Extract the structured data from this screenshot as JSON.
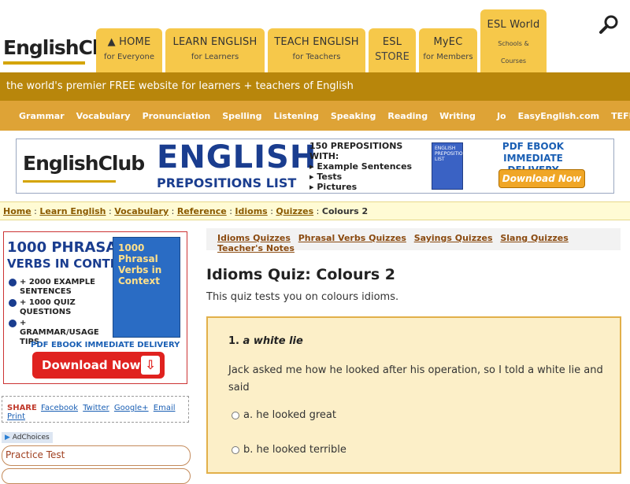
{
  "header": {
    "logo": "EnglishClub",
    "tabs": [
      {
        "line1": "HOME",
        "line2": "for Everyone",
        "icon": "home-icon"
      },
      {
        "line1": "LEARN ENGLISH",
        "line2": "for Learners"
      },
      {
        "line1": "TEACH ENGLISH",
        "line2": "for Teachers"
      },
      {
        "line1": "ESL",
        "line2": "STORE"
      },
      {
        "line1": "MyEC",
        "line2": "for Members"
      },
      {
        "line1": "ESL World",
        "line2": "Schools &",
        "line3": "Courses"
      }
    ]
  },
  "tagline": "the world's premier FREE website for learners + teachers of English",
  "subnav": [
    "Grammar",
    "Vocabulary",
    "Pronunciation",
    "Spelling",
    "Listening",
    "Speaking",
    "Reading",
    "Writing",
    "Jo",
    "EasyEnglish.com",
    "TEFL.net"
  ],
  "banner": {
    "logo": "EnglishClub",
    "english": "ENGLISH",
    "prep": "PREPOSITIONS LIST",
    "heading": "150 PREPOSITIONS WITH:",
    "bullets": [
      "Example Sentences",
      "Tests",
      "Pictures"
    ],
    "book_text": "ENGLISH PREPOSITIONS LIST",
    "pdf_line1": "PDF EBOOK",
    "pdf_line2": "IMMEDIATE DELIVERY",
    "download": "Download Now"
  },
  "breadcrumb": {
    "items": [
      "Home",
      "Learn English",
      "Vocabulary",
      "Reference",
      "Idioms",
      "Quizzes"
    ],
    "current": "Colours 2"
  },
  "sidebar": {
    "ad_title_1": "1000 PHRASAL",
    "ad_title_2": "VERBS IN CONTEXT",
    "book_title": "1000 Phrasal Verbs in Context",
    "bullets": [
      "+ 2000 EXAMPLE SENTENCES",
      "+ 1000 QUIZ QUESTIONS",
      "+ GRAMMAR/USAGE TIPS"
    ],
    "pdf": "PDF EBOOK IMMEDIATE DELIVERY",
    "download": "Download Now!",
    "share_label": "SHARE",
    "share_links": [
      "Facebook",
      "Twitter",
      "Google+",
      "Email",
      "Print"
    ],
    "adchoices": "AdChoices",
    "practice": "Practice Test"
  },
  "main": {
    "quiz_nav": [
      "Idioms Quizzes",
      "Phrasal Verbs Quizzes",
      "Sayings Quizzes",
      "Slang Quizzes",
      "Teacher's Notes"
    ],
    "title": "Idioms Quiz: Colours 2",
    "intro": "This quiz tests you on colours idioms.",
    "question_number": "1.",
    "question_idiom": "a white lie",
    "question_text": "Jack asked me how he looked after his operation, so I told a white lie and said",
    "options": [
      "a. he looked great",
      "b. he looked terrible"
    ]
  },
  "colors": {
    "tab": "#f6c84a",
    "tagline_bar": "#b8860b",
    "subnav": "#dea336",
    "quiz_bg": "#fcefc8"
  }
}
